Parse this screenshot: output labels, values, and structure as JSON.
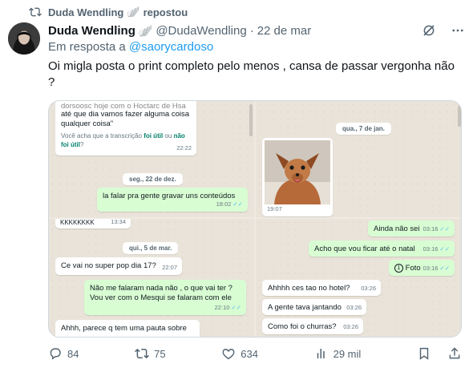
{
  "repost": {
    "user": "Duda Wendling",
    "badge": "🪽",
    "label": "repostou"
  },
  "tweet": {
    "name": "Duda Wendling",
    "badge": "🪽",
    "handle": "@DudaWendling",
    "sep": "·",
    "date": "22 de mar",
    "reply_prefix": "Em resposta a",
    "reply_to": "@saorycardoso",
    "text": "Oi migla posta o print completo pelo menos , cansa de passar vergonha não ?"
  },
  "screenshot": {
    "panel1": {
      "cut_text": "dorsoosc hoje com o Hoctarc de Hsa",
      "line1": "até que dia vamos fazer alguma coisa",
      "line2": "qualquer coisa\"",
      "question_prefix": "Você acha que a transcrição",
      "link1": "foi útil",
      "or": "ou",
      "link2": "não foi útil",
      "question_suffix": "?",
      "time1": "22:22",
      "date_chip": "seg., 22 de dez.",
      "msg": "la falar pra gente gravar uns conteúdos",
      "time2": "18:02"
    },
    "panel2": {
      "date_chip": "qua., 7 de jan.",
      "photo_time": "19:07"
    },
    "panel3": {
      "laugh": "KKKKKKKK",
      "laugh_time": "13:34",
      "date_chip": "qui., 5 de mar.",
      "msg1": "Ce vai no super pop dia 17?",
      "msg1_time": "22:07",
      "msg2_l1": "Não me falaram nada não , o que vai ter ?",
      "msg2_l2": "Vou ver com o Mesqui se falaram com ele",
      "msg2_time": "22:10",
      "msg3": "Ahhh, parece q tem uma pauta sobre"
    },
    "panel4": {
      "m1": "Ainda não sei",
      "t1": "03:16",
      "m2": "Acho que vou ficar até o natal",
      "t2": "03:16",
      "m3": "Foto",
      "t3": "03:16",
      "m4": "Ahhhh ces tao no hotel?",
      "t4": "03:26",
      "m5": "A gente tava jantando",
      "t5": "03:26",
      "m6": "Como foi o churras?",
      "t6": "03:26"
    }
  },
  "stats": {
    "replies": "84",
    "reposts": "75",
    "likes": "634",
    "views": "29 mil"
  },
  "icons": [
    "repost-icon",
    "grok-icon",
    "more-icon",
    "reply-icon",
    "like-icon",
    "views-icon",
    "bookmark-icon",
    "share-icon"
  ],
  "colors": {
    "link": "#1d9bf0",
    "muted": "#536471",
    "outgoing_bubble": "#d9fdd3",
    "chat_bg": "#e9e3d9"
  }
}
